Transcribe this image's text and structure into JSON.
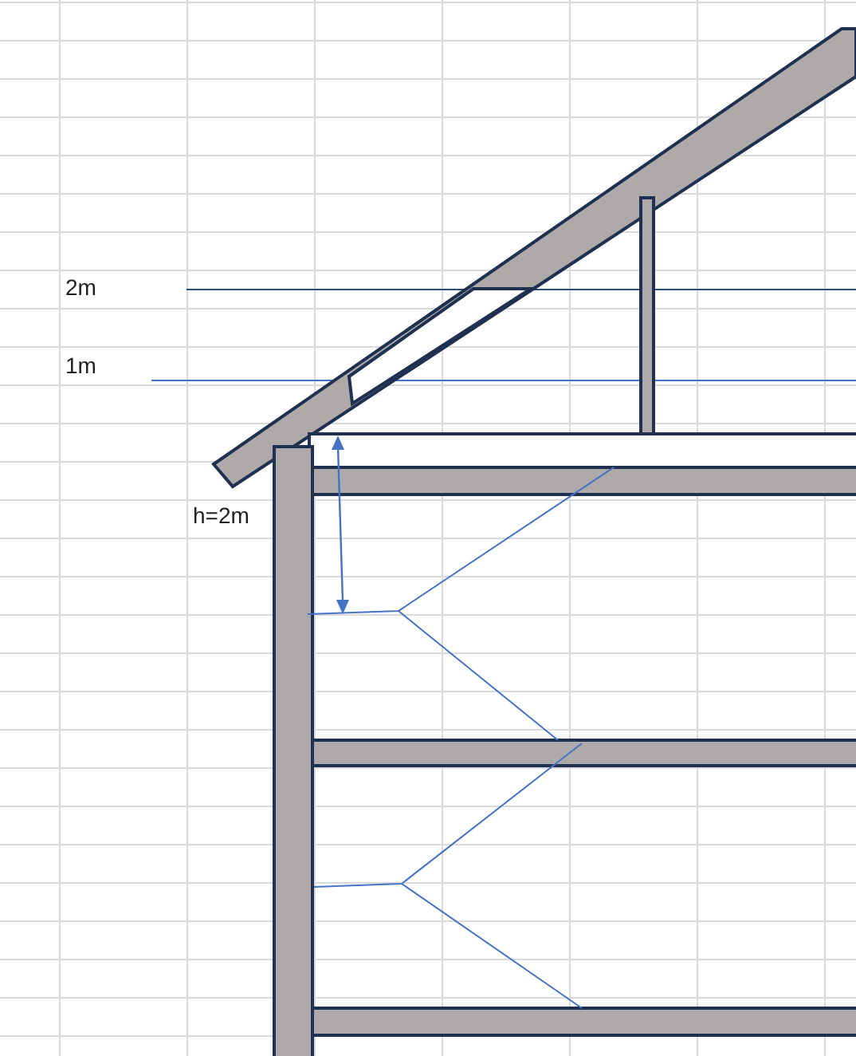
{
  "labels": [
    {
      "text": "2m"
    },
    {
      "text": "1m"
    },
    {
      "text": "h=2m"
    }
  ]
}
